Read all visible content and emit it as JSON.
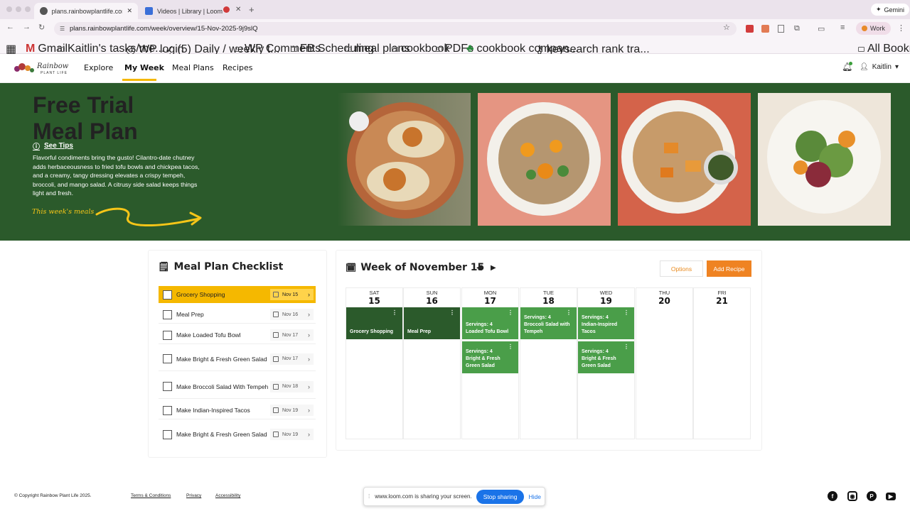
{
  "browser": {
    "tabs": [
      {
        "label": "plans.rainbowplantlife.com/w",
        "favicon_color": "#555555"
      },
      {
        "label": "Videos | Library | Loom",
        "favicon_color": "#3b6fd8"
      }
    ],
    "url": "plans.rainbowplantlife.com/week/overview/15-Nov-2025-9j9slQ",
    "gemini": "Gemini",
    "profile": "Work",
    "bookmarks": [
      "Gmail",
      "Kaitlin's tasks/me...",
      "WP login",
      "(5) Daily / weekly t...",
      "WP Comments",
      "FB Scheduling",
      "meal plans",
      "cookbook",
      "PDFs",
      "cookbook compan...",
      "keysearch rank tra..."
    ],
    "all_bookmarks": "All Bookmarks"
  },
  "nav": {
    "logo_text": "Rainbow Plant Life",
    "links": [
      "Explore",
      "My Week",
      "Meal Plans",
      "Recipes"
    ],
    "user": "Kaitlin"
  },
  "hero": {
    "title": "Free Trial Meal Plan",
    "see_tips": "See Tips",
    "description": "Flavorful condiments bring the gusto! Cilantro-date chutney adds herbaceousness to fried tofu bowls and chickpea tacos, and a creamy, tangy dressing elevates a crispy tempeh, broccoli, and mango salad. A citrusy side salad keeps things light and fresh.",
    "weeks_meals": "This week's meals"
  },
  "checklist": {
    "title": "Meal Plan Checklist",
    "items": [
      {
        "label": "Grocery Shopping",
        "date": "Nov 15"
      },
      {
        "label": "Meal Prep",
        "date": "Nov 16"
      },
      {
        "label": "Make Loaded Tofu Bowl",
        "date": "Nov 17"
      },
      {
        "label": "Make Bright & Fresh Green Salad",
        "date": "Nov 17"
      },
      {
        "label": "Make Broccoli Salad With Tempeh",
        "date": "Nov 18"
      },
      {
        "label": "Make Indian-Inspired Tacos",
        "date": "Nov 19"
      },
      {
        "label": "Make Bright & Fresh Green Salad",
        "date": "Nov 19"
      }
    ]
  },
  "calendar": {
    "title": "Week of November 15",
    "options": "Options",
    "add_recipe": "Add Recipe",
    "days": [
      {
        "name": "SAT",
        "num": "15"
      },
      {
        "name": "SUN",
        "num": "16"
      },
      {
        "name": "MON",
        "num": "17"
      },
      {
        "name": "TUE",
        "num": "18"
      },
      {
        "name": "WED",
        "num": "19"
      },
      {
        "name": "THU",
        "num": "20"
      },
      {
        "name": "FRI",
        "num": "21"
      }
    ],
    "events": {
      "grocery": "Grocery Shopping",
      "mealprep": "Meal Prep",
      "mon1_serv": "Servings: 4",
      "mon1": "Loaded Tofu Bowl",
      "mon2_serv": "Servings: 4",
      "mon2": "Bright & Fresh Green Salad",
      "tue1_serv": "Servings: 4",
      "tue1": "Broccoli Salad with Tempeh",
      "wed1_serv": "Servings: 4",
      "wed1": "Indian-Inspired Tacos",
      "wed2_serv": "Servings: 4",
      "wed2": "Bright & Fresh Green Salad"
    }
  },
  "footer": {
    "copyright": "© Copyright Rainbow Plant Life 2025.",
    "terms": "Terms & Conditions",
    "privacy": "Privacy",
    "accessibility": "Accessibility"
  },
  "loom": {
    "message": "www.loom.com is sharing your screen.",
    "stop": "Stop sharing",
    "hide": "Hide"
  },
  "colors": {
    "brand_green": "#2b5a2b",
    "event_green": "#4a9e49",
    "accent_yellow": "#f5b800",
    "accent_orange": "#ef8322"
  }
}
